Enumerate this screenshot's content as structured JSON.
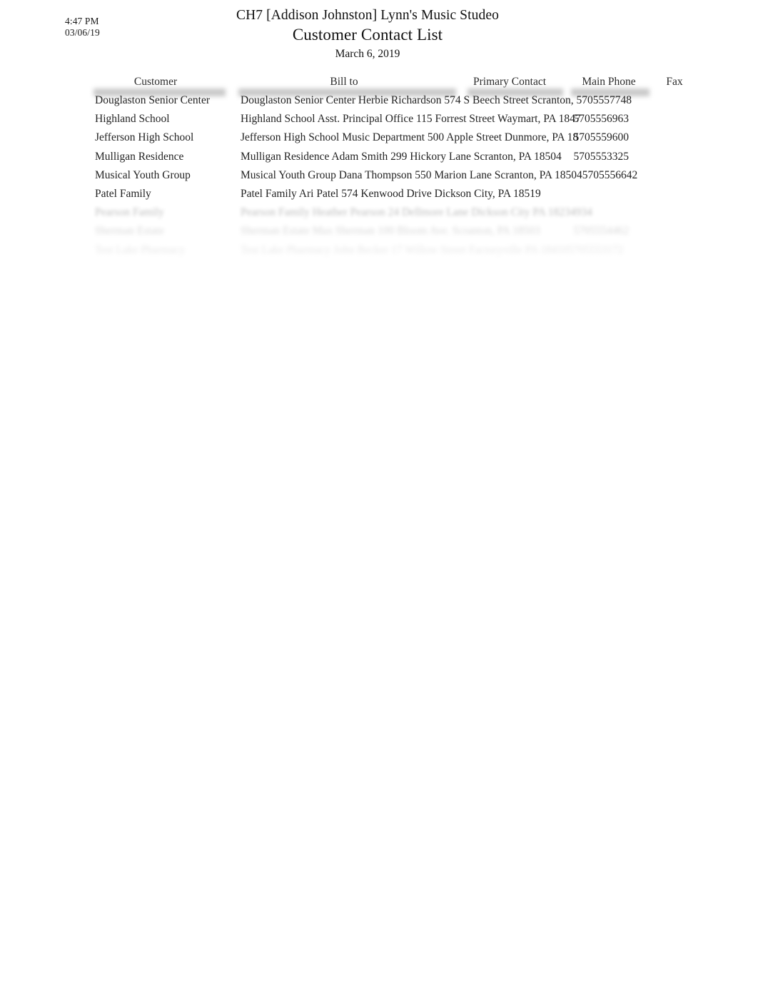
{
  "page": {
    "background_color": "#ffffff",
    "text_color": "#232323"
  },
  "header": {
    "print_time": "4:47 PM",
    "print_date": "03/06/19",
    "title": "CH7 [Addison Johnston] Lynn's Music Studeo",
    "subtitle": "Customer Contact List",
    "date_line": "March 6, 2019"
  },
  "table": {
    "columns": [
      {
        "key": "customer",
        "label": "Customer"
      },
      {
        "key": "bill_to",
        "label": "Bill to"
      },
      {
        "key": "primary_contact",
        "label": "Primary Contact"
      },
      {
        "key": "main_phone",
        "label": "Main Phone"
      },
      {
        "key": "fax",
        "label": "Fax"
      }
    ],
    "rows": [
      {
        "customer": "Douglaston Senior Center",
        "bill_to": "Douglaston Senior Center Herbie Richardson 574 S Beech Street Scranton, 5705557748",
        "main_phone": "",
        "legible": true
      },
      {
        "customer": "Highland School",
        "bill_to": "Highland School Asst. Principal Office 115 Forrest Street Waymart, PA 1847",
        "main_phone": "5705556963",
        "legible": true
      },
      {
        "customer": "Jefferson High School",
        "bill_to": "Jefferson High School Music Department 500 Apple Street Dunmore, PA 18",
        "main_phone": "5705559600",
        "legible": true
      },
      {
        "customer": "Mulligan Residence",
        "bill_to": "Mulligan Residence Adam Smith 299 Hickory Lane Scranton, PA 18504",
        "main_phone": "5705553325",
        "legible": true
      },
      {
        "customer": "Musical Youth Group",
        "bill_to": "Musical Youth Group Dana Thompson 550 Marion Lane Scranton, PA 185045705556642",
        "main_phone": "",
        "legible": true
      },
      {
        "customer": "Patel Family",
        "bill_to": "Patel Family Ari Patel 574 Kenwood Drive Dickson City, PA 18519",
        "main_phone": "",
        "legible": true
      },
      {
        "customer": "Pearson Family",
        "bill_to": "Pearson Family Heather Pearson 24 Dellmore Lane Dickson City PA 18234934",
        "main_phone": "",
        "legible": false
      },
      {
        "customer": "Sherman Estate",
        "bill_to": "Sherman Estate Max Sherman 100 Bloom Ave. Scranton, PA 18503",
        "main_phone": "5705554462",
        "legible": false
      },
      {
        "customer": "Test Lake Pharmacy",
        "bill_to": "Test Lake Pharmacy John Becker 17 Willow Street Factoryville PA 184105705553172",
        "main_phone": "",
        "legible": false
      }
    ]
  }
}
